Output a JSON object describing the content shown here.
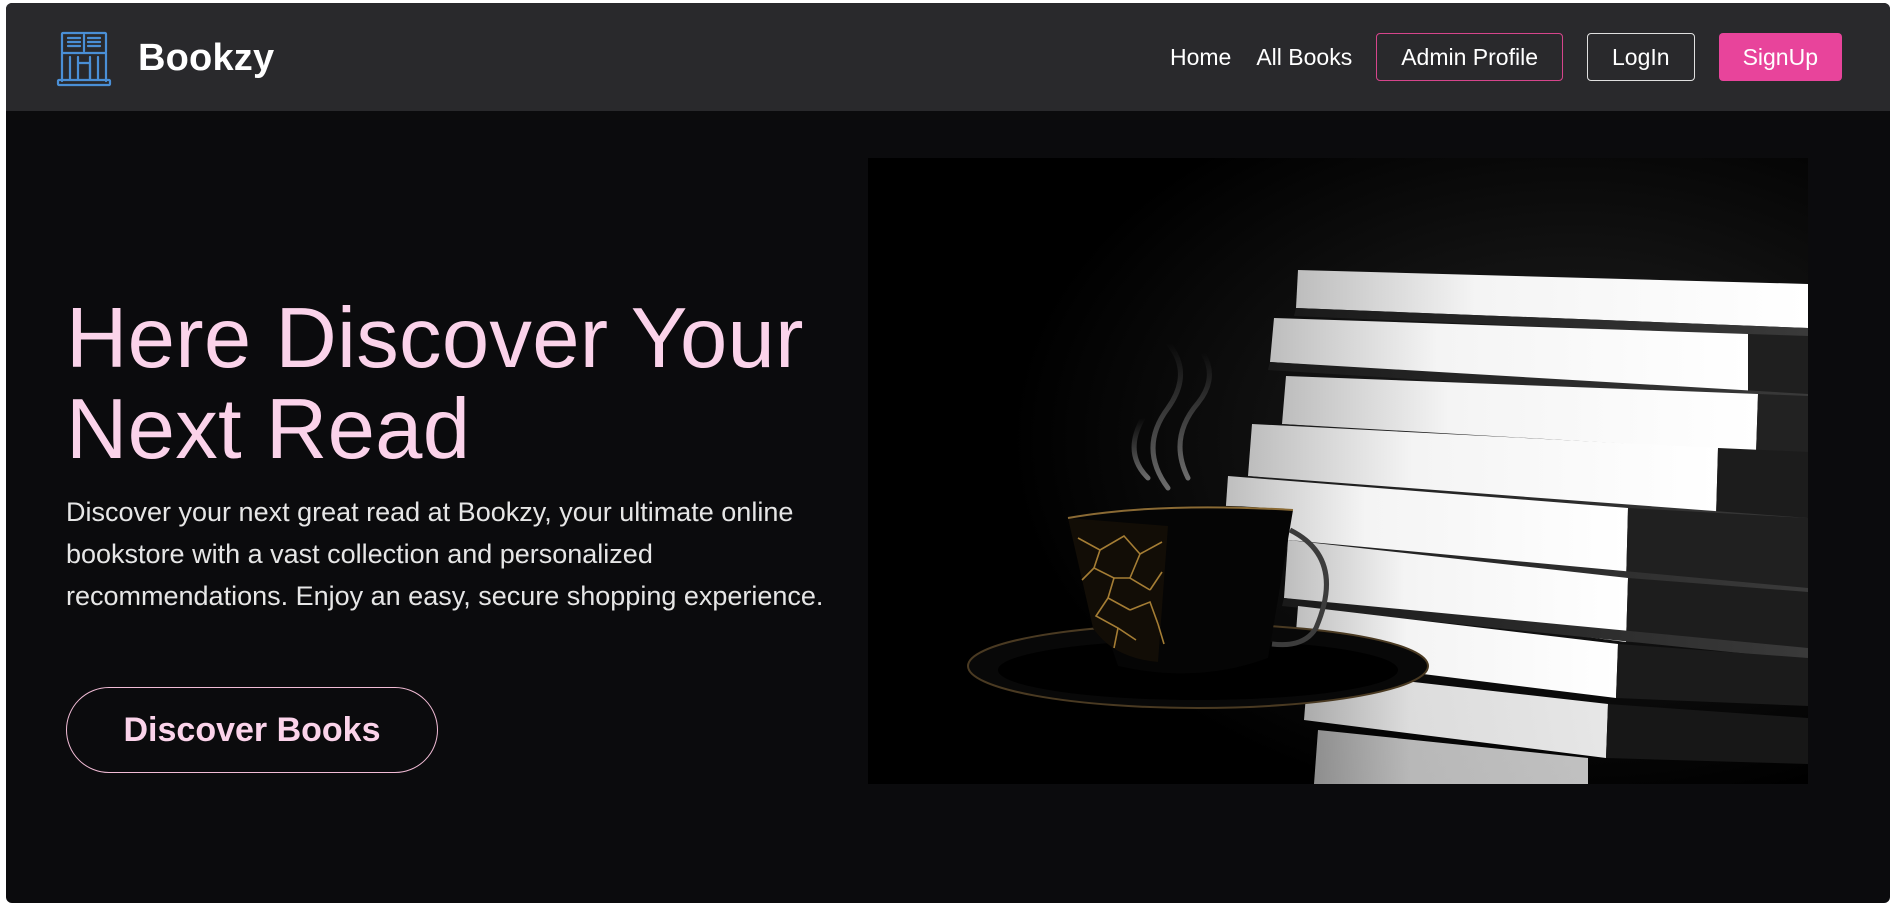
{
  "brand": {
    "name": "Bookzy",
    "icon": "library-building-icon",
    "icon_color": "#4a8fd6"
  },
  "nav": {
    "links": [
      "Home",
      "All Books"
    ],
    "admin_label": "Admin Profile",
    "login_label": "LogIn",
    "signup_label": "SignUp"
  },
  "hero": {
    "title": "Here Discover Your Next Read",
    "description": "Discover your next great read at Bookzy, your ultimate online bookstore with a vast collection and personalized recommendations. Enjoy an easy, secure shopping experience.",
    "button_label": "Discover Books",
    "image": "coffee-cup-and-book-stack-photo"
  },
  "colors": {
    "accent_pink": "#e8449b",
    "title_pink": "#fbd3ea",
    "navbar_bg": "#29292c",
    "page_bg": "#0b0b0d"
  }
}
